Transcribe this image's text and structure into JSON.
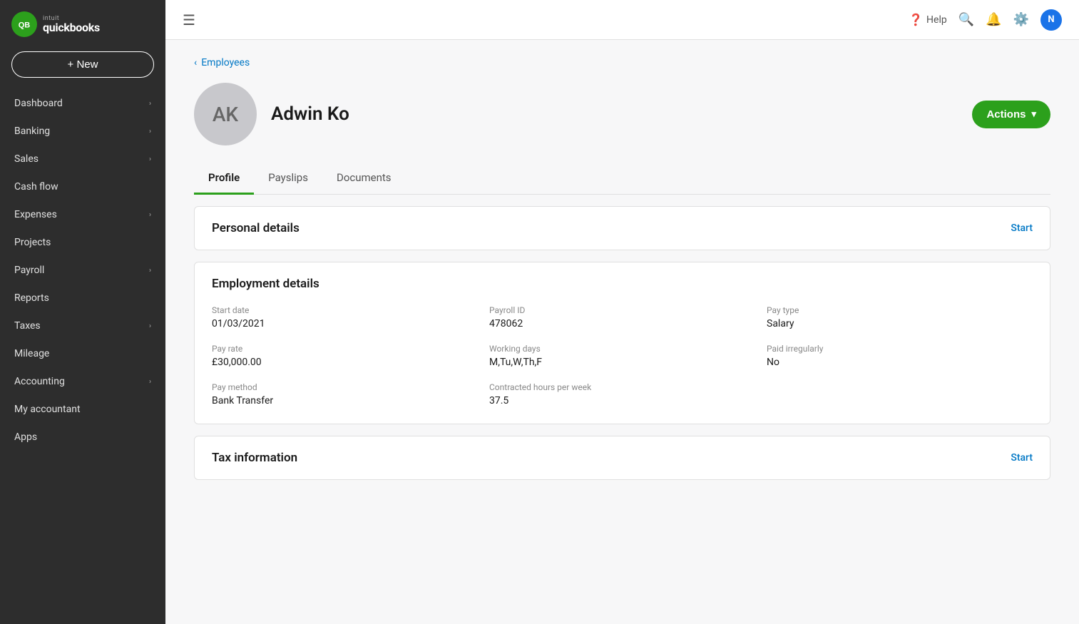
{
  "brand": {
    "intuit": "intuit",
    "name": "quickbooks",
    "logo_initials": "QB"
  },
  "new_button": "+ New",
  "nav": {
    "items": [
      {
        "label": "Dashboard",
        "has_chevron": true
      },
      {
        "label": "Banking",
        "has_chevron": true
      },
      {
        "label": "Sales",
        "has_chevron": true
      },
      {
        "label": "Cash flow",
        "has_chevron": false
      },
      {
        "label": "Expenses",
        "has_chevron": true
      },
      {
        "label": "Projects",
        "has_chevron": false
      },
      {
        "label": "Payroll",
        "has_chevron": true
      },
      {
        "label": "Reports",
        "has_chevron": false
      },
      {
        "label": "Taxes",
        "has_chevron": true
      },
      {
        "label": "Mileage",
        "has_chevron": false
      },
      {
        "label": "Accounting",
        "has_chevron": true
      },
      {
        "label": "My accountant",
        "has_chevron": false
      },
      {
        "label": "Apps",
        "has_chevron": false
      }
    ]
  },
  "topbar": {
    "help_label": "Help",
    "user_initial": "N"
  },
  "breadcrumb": "Employees",
  "employee": {
    "initials": "AK",
    "name": "Adwin Ko"
  },
  "actions_button": "Actions",
  "tabs": [
    {
      "label": "Profile",
      "active": true
    },
    {
      "label": "Payslips",
      "active": false
    },
    {
      "label": "Documents",
      "active": false
    }
  ],
  "personal_details": {
    "title": "Personal details",
    "action": "Start"
  },
  "employment_details": {
    "title": "Employment details",
    "fields": [
      {
        "label": "Start date",
        "value": "01/03/2021"
      },
      {
        "label": "Payroll ID",
        "value": "478062"
      },
      {
        "label": "Pay type",
        "value": "Salary"
      },
      {
        "label": "Pay rate",
        "value": "£30,000.00"
      },
      {
        "label": "Working days",
        "value": "M,Tu,W,Th,F"
      },
      {
        "label": "Paid irregularly",
        "value": "No"
      },
      {
        "label": "Pay method",
        "value": "Bank Transfer"
      },
      {
        "label": "Contracted hours per week",
        "value": "37.5"
      }
    ]
  },
  "tax_information": {
    "title": "Tax information",
    "action": "Start"
  }
}
